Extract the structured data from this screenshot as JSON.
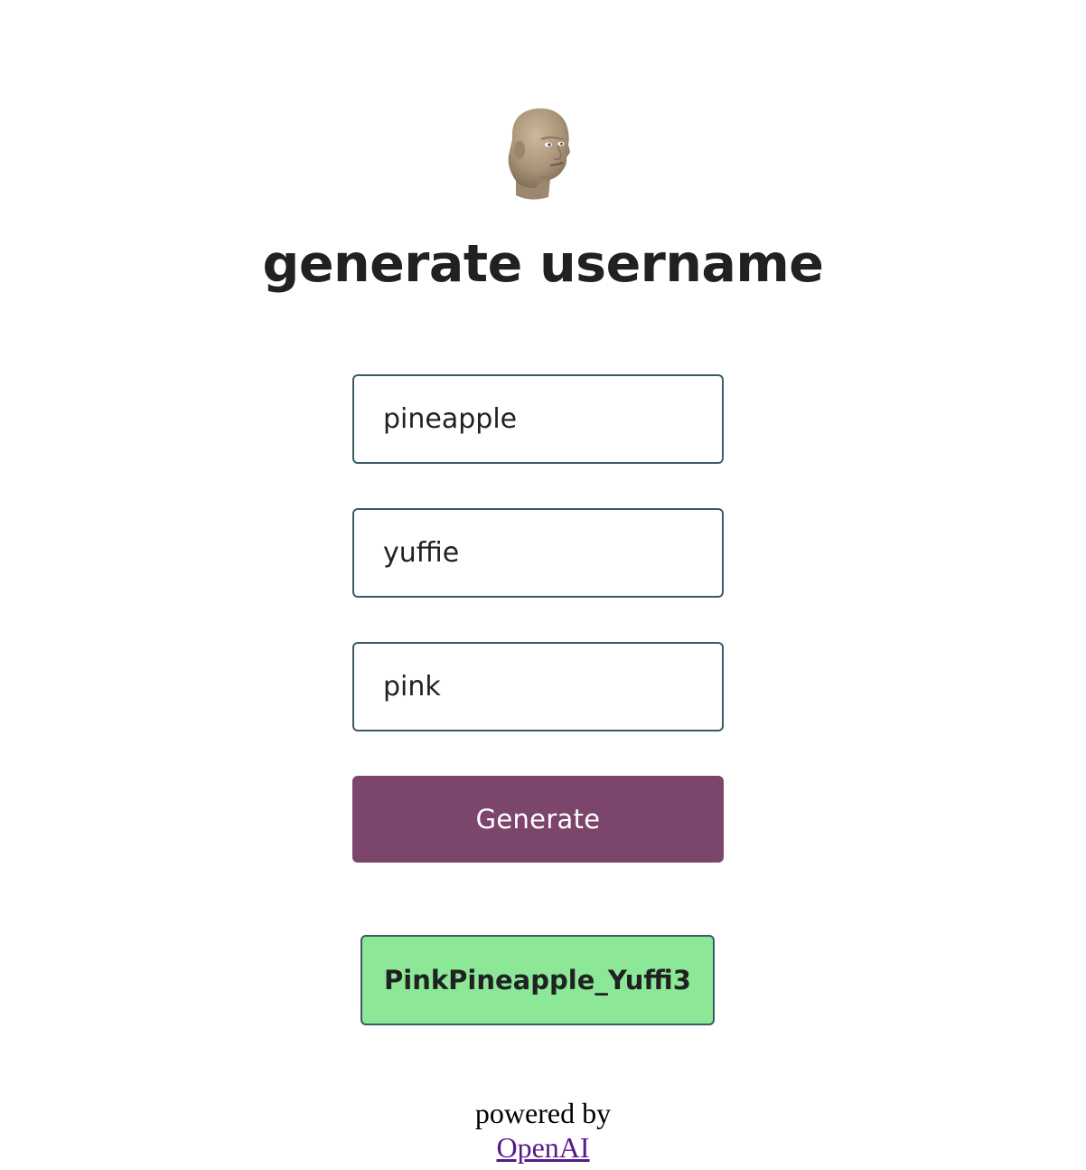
{
  "app": {
    "logo_icon": "meme-man-head-icon",
    "title": "generate username"
  },
  "form": {
    "fields": [
      {
        "value": "pineapple"
      },
      {
        "value": "yuffie"
      },
      {
        "value": "pink"
      }
    ],
    "generate_label": "Generate"
  },
  "result": {
    "username": "PinkPineapple_Yuffi3"
  },
  "footer": {
    "powered_by": "powered by",
    "link_label": "OpenAI"
  },
  "colors": {
    "button_bg": "#7b456c",
    "result_bg": "#8ce896",
    "field_border": "#3b5a63",
    "text": "#202123",
    "link": "#551a8b"
  }
}
